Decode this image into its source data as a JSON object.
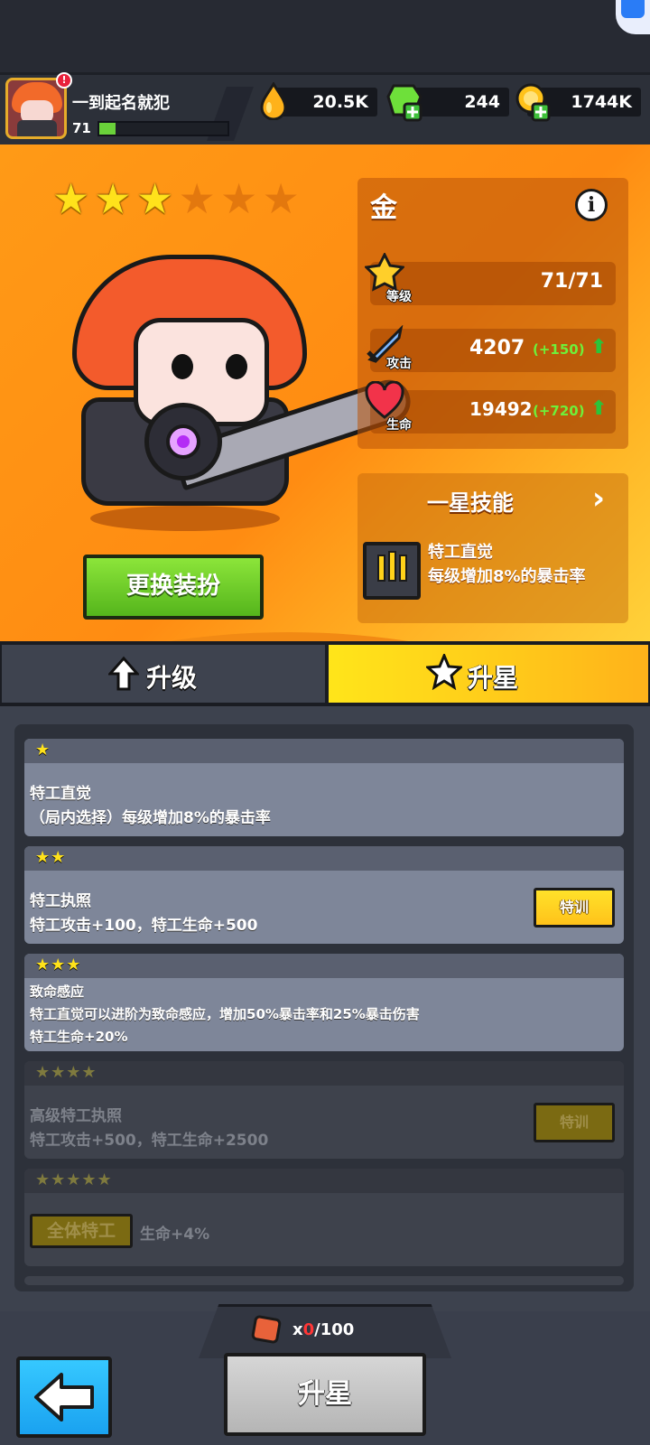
{
  "player": {
    "name": "一到起名就犯",
    "level": "71",
    "exp_fraction": 0.13,
    "alert": "!"
  },
  "resources": {
    "oil": "20.5K",
    "gems": "244",
    "coins": "1744K"
  },
  "hero": {
    "stars_total": 6,
    "stars_filled": 3,
    "grade": "金",
    "change_outfit_label": "更换装扮",
    "stats": {
      "level_label": "等级",
      "level_value": "71/71",
      "attack_label": "攻击",
      "attack_value": "4207",
      "attack_bonus": "(+150)",
      "hp_label": "生命",
      "hp_value": "19492",
      "hp_bonus": "(+720)"
    },
    "skill": {
      "title": "一星技能",
      "name": "特工直觉",
      "desc": "每级增加8%的暴击率"
    }
  },
  "tabs": {
    "upgrade": "升级",
    "star_up": "升星"
  },
  "star_list": [
    {
      "stars": 1,
      "unlocked": true,
      "lines": [
        "特工直觉",
        "（局内选择）每级增加8%的暴击率"
      ]
    },
    {
      "stars": 2,
      "unlocked": true,
      "lines": [
        "特工执照",
        "特工攻击+100，特工生命+500"
      ],
      "button": "特训"
    },
    {
      "stars": 3,
      "unlocked": true,
      "lines": [
        "致命感应",
        "特工直觉可以进阶为致命感应，增加50%暴击率和25%暴击伤害",
        "特工生命+20%"
      ]
    },
    {
      "stars": 4,
      "unlocked": false,
      "lines": [
        "高级特工执照",
        "特工攻击+500，特工生命+2500"
      ],
      "button": "特训"
    },
    {
      "stars": 5,
      "unlocked": false,
      "tag": "全体特工",
      "lines": [
        "生命+4%"
      ]
    }
  ],
  "bottom": {
    "fragment_prefix": "x",
    "fragment_have": "0",
    "fragment_need": "/100",
    "star_up_button": "升星"
  },
  "colors": {
    "hero_bg": "#ff9a16",
    "star_on": "#ffe21b",
    "star_off": "#e3780e",
    "bonus_green": "#6ef03a",
    "tab_active": "#ffd21a",
    "back_button": "#1aa2f0"
  }
}
